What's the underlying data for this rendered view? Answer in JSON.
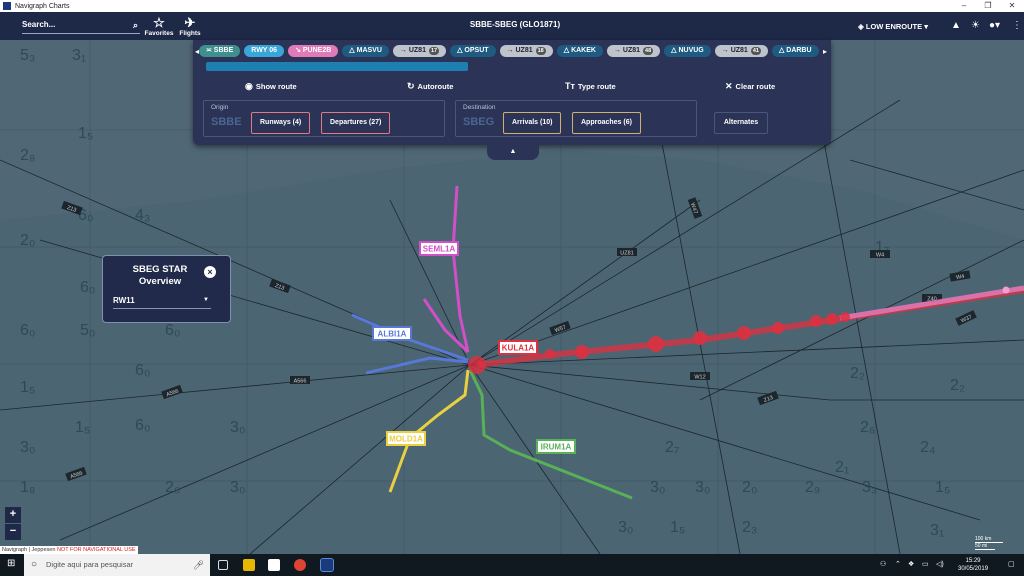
{
  "window": {
    "title": "Navigraph Charts",
    "minimize": "–",
    "maximize": "❐",
    "close": "✕"
  },
  "topbar": {
    "search_placeholder": "Search...",
    "favorites_label": "Favorites",
    "flights_label": "Flights",
    "route_title": "SBBE-SBEG (GLO1871)",
    "layer_label": "LOW ENROUTE"
  },
  "route_chips": [
    {
      "label": "SBBE",
      "kind": "origin",
      "prefix": "≍"
    },
    {
      "label": "RWY 06",
      "kind": "rwy",
      "prefix": ""
    },
    {
      "label": "PUNE2B",
      "kind": "dep",
      "prefix": "↘"
    },
    {
      "label": "MASVU",
      "kind": "wp",
      "prefix": "△"
    },
    {
      "label": "UZ81",
      "kind": "aw",
      "prefix": "→",
      "count": "17"
    },
    {
      "label": "OPSUT",
      "kind": "wp",
      "prefix": "△"
    },
    {
      "label": "UZ81",
      "kind": "aw",
      "prefix": "→",
      "count": "18"
    },
    {
      "label": "KAKEK",
      "kind": "wp",
      "prefix": "△"
    },
    {
      "label": "UZ81",
      "kind": "aw",
      "prefix": "→",
      "count": "48"
    },
    {
      "label": "NUVUG",
      "kind": "wp",
      "prefix": "△"
    },
    {
      "label": "UZ81",
      "kind": "aw",
      "prefix": "→",
      "count": "41"
    },
    {
      "label": "DARBU",
      "kind": "wp",
      "prefix": "△"
    }
  ],
  "actions": {
    "show_route": "Show route",
    "autoroute": "Autoroute",
    "type_route": "Type route",
    "clear_route": "Clear route"
  },
  "origin": {
    "label": "Origin",
    "code": "SBBE",
    "runways": "Runways (4)",
    "departures": "Departures (27)"
  },
  "destination": {
    "label": "Destination",
    "code": "SBEG",
    "arrivals": "Arrivals (10)",
    "approaches": "Approaches (6)"
  },
  "alternates_label": "Alternates",
  "star_panel": {
    "title": "SBEG STAR Overview",
    "runway": "RW11"
  },
  "map": {
    "procedures": [
      {
        "name": "SEML1A",
        "color": "#d050c8"
      },
      {
        "name": "ALBI1A",
        "color": "#5878d8"
      },
      {
        "name": "KULA1A",
        "color": "#e03040"
      },
      {
        "name": "MOLD1A",
        "color": "#e8d040"
      },
      {
        "name": "IRUM1A",
        "color": "#58b058"
      }
    ],
    "airway_labels": [
      "Z13",
      "Z13",
      "A566",
      "A566",
      "W47",
      "UZ81",
      "W4",
      "W4",
      "Z40",
      "W57",
      "W37",
      "W12",
      "Z13",
      "A566"
    ],
    "mora_values": [
      "5₃",
      "3₁",
      "2₈",
      "2₀",
      "6₀",
      "1₅",
      "1₅",
      "6₀",
      "4₃",
      "6₀",
      "6₀",
      "5₀",
      "6₀",
      "6₀",
      "3₀",
      "1₅",
      "3₀",
      "3₀",
      "1₇",
      "2₂",
      "2₆",
      "2₁",
      "2₉",
      "3₃",
      "1₅",
      "2₇",
      "3₀",
      "3₀",
      "2₀",
      "2₃",
      "3₀",
      "1₅",
      "2₀",
      "1₈",
      "2₄",
      "2₂",
      "3₁"
    ]
  },
  "zoom": {
    "in": "+",
    "out": "−"
  },
  "attribution": {
    "text": "Navigraph | Jeppesen",
    "warning": "NOT FOR NAVIGATIONAL USE"
  },
  "scale": {
    "km": "100 km",
    "nm": "50 mi"
  },
  "taskbar": {
    "search_placeholder": "Digite aqui para pesquisar",
    "time": "15:29",
    "date": "30/05/2019"
  }
}
